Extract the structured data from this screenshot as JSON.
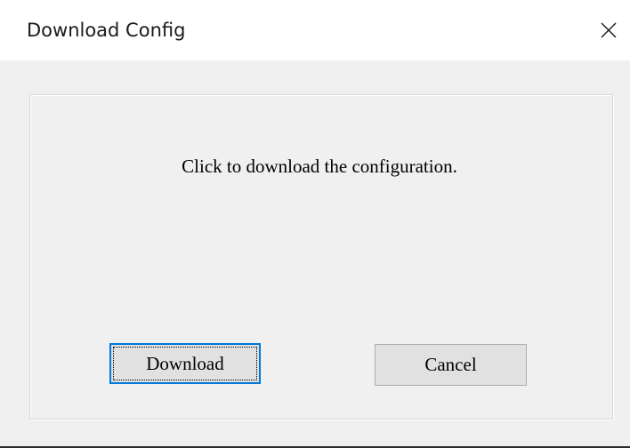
{
  "window": {
    "title": "Download Config",
    "close_icon": "close-icon"
  },
  "dialog": {
    "message": "Click to download the configuration.",
    "download_label": "Download",
    "cancel_label": "Cancel"
  }
}
